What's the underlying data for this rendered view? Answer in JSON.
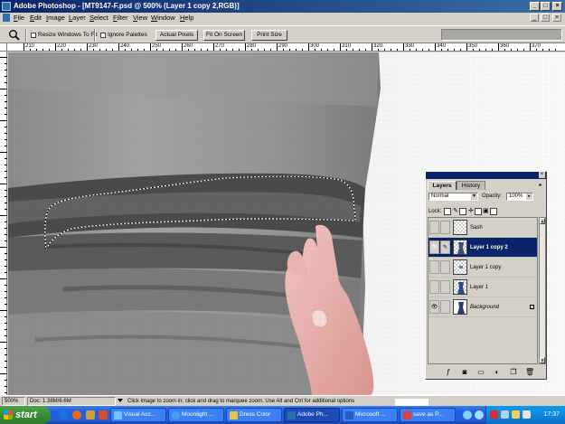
{
  "window": {
    "title": "Adobe Photoshop - [MT9147-F.psd @ 500% (Layer 1 copy 2,RGB)]",
    "min_glyph": "_",
    "max_glyph": "□",
    "close_glyph": "×"
  },
  "menu": {
    "items": [
      {
        "key": "F",
        "rest": "ile"
      },
      {
        "key": "E",
        "rest": "dit"
      },
      {
        "key": "I",
        "rest": "mage"
      },
      {
        "key": "L",
        "rest": "ayer"
      },
      {
        "key": "S",
        "rest": "elect"
      },
      {
        "key": "F",
        "rest": "ilter"
      },
      {
        "key": "V",
        "rest": "iew"
      },
      {
        "key": "W",
        "rest": "indow"
      },
      {
        "key": "H",
        "rest": "elp"
      }
    ]
  },
  "options": {
    "resize_label": "Resize Windows To Fit",
    "ignore_label": "Ignore Palettes",
    "actual_pixels": "Actual Pixels",
    "fit_on_screen": "Fit On Screen",
    "print_size": "Print Size"
  },
  "ruler": {
    "labels": [
      "210",
      "220",
      "230",
      "240",
      "250",
      "260",
      "270",
      "280",
      "290",
      "300",
      "310",
      "320",
      "330",
      "340",
      "350",
      "360",
      "370"
    ]
  },
  "layers": {
    "tab_layers": "Layers",
    "tab_history": "History",
    "menu_glyph": "▸",
    "blend_mode": "Normal",
    "opacity_label": "Opacity:",
    "opacity_value": "100%",
    "lock_label": "Lock:",
    "rows": [
      {
        "name": "Sash",
        "visible": "",
        "selected": false
      },
      {
        "name": "Layer 1 copy 2",
        "visible": "👁",
        "selected": true
      },
      {
        "name": "Layer 1 copy",
        "visible": "",
        "selected": false
      },
      {
        "name": "Layer 1",
        "visible": "",
        "selected": false
      },
      {
        "name": "Background",
        "visible": "👁",
        "selected": false
      }
    ]
  },
  "status": {
    "zoom": "500%",
    "doc": "Doc: 1.38M/6.6M",
    "hint": "Click image to zoom in; click and drag to marquee zoom. Use Alt and Ctrl for additional options"
  },
  "taskbar": {
    "start": "start",
    "tasks": [
      "Visual Acc...",
      "Moonlight ...",
      "Dress Color",
      "Adobe Ph...",
      "Microsoft ...",
      "save as P..."
    ],
    "clock": "17:37"
  },
  "colors": {
    "title_start": "#0a246a",
    "title_end": "#3a6ea5",
    "selection": "#0a246a",
    "taskbar": "#245edc",
    "start_green": "#388e38",
    "tray": "#0f88dd"
  }
}
